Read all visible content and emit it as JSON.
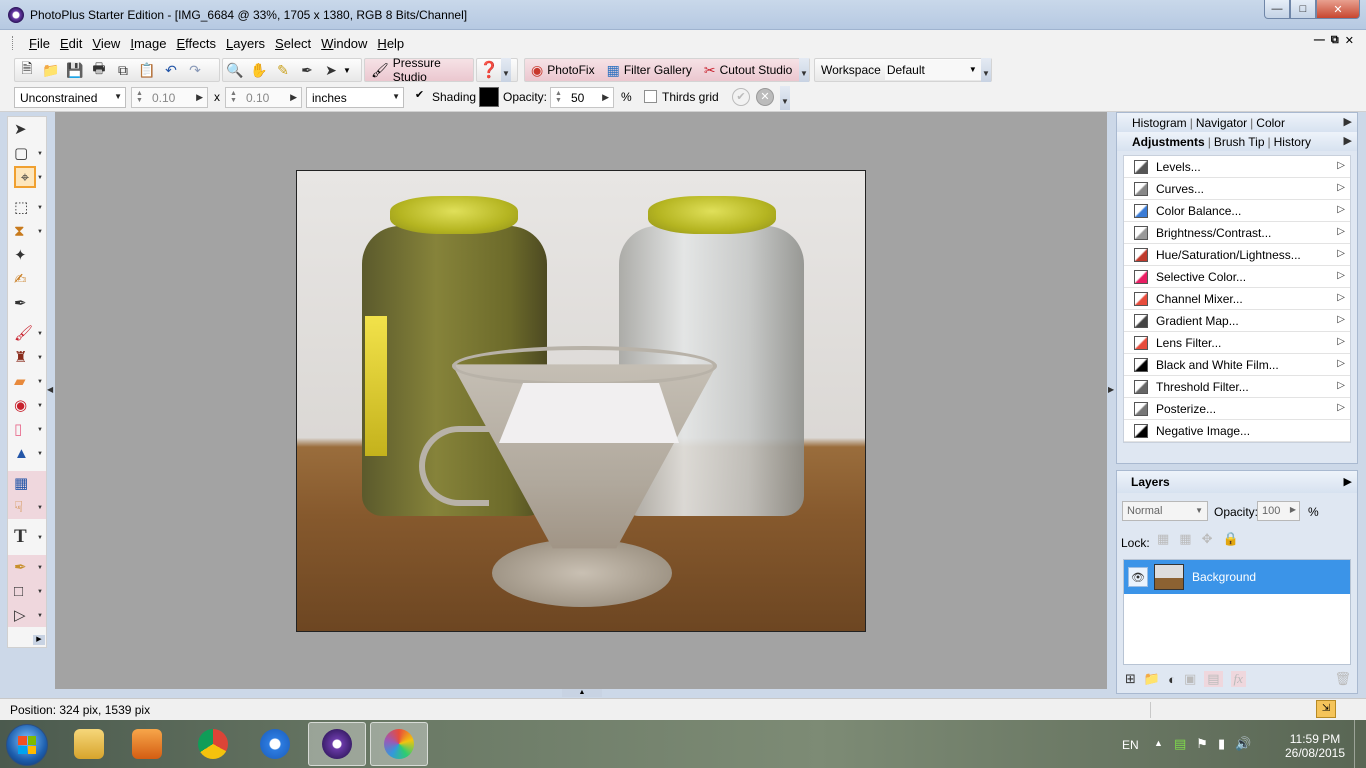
{
  "window": {
    "title": "PhotoPlus Starter Edition - [IMG_6684 @ 33%, 1705 x 1380, RGB 8 Bits/Channel]"
  },
  "menu": [
    "File",
    "Edit",
    "View",
    "Image",
    "Effects",
    "Layers",
    "Select",
    "Window",
    "Help"
  ],
  "toolbar": {
    "pressure_studio": "Pressure Studio",
    "photofix": "PhotoFix",
    "filter_gallery": "Filter Gallery",
    "cutout_studio": "Cutout Studio",
    "workspace_label": "Workspace",
    "workspace_value": "Default"
  },
  "context_bar": {
    "constraint": "Unconstrained",
    "width": "0.10",
    "times": "x",
    "height": "0.10",
    "units": "inches",
    "shading_label": "Shading",
    "shading_checked": "✔",
    "opacity_label": "Opacity:",
    "opacity_value": "50",
    "percent": "%",
    "thirds_grid_label": "Thirds grid"
  },
  "panels": {
    "top_tabs": [
      "Histogram",
      "Navigator",
      "Color"
    ],
    "adj_tabs": [
      "Adjustments",
      "Brush Tip",
      "History"
    ],
    "adjustments": [
      {
        "label": "Levels...",
        "icon": "levels-icon",
        "color": "#555555"
      },
      {
        "label": "Curves...",
        "icon": "curves-icon",
        "color": "#888888"
      },
      {
        "label": "Color Balance...",
        "icon": "color-balance-icon",
        "color": "#3a7bd5"
      },
      {
        "label": "Brightness/Contrast...",
        "icon": "brightness-icon",
        "color": "#999999"
      },
      {
        "label": "Hue/Saturation/Lightness...",
        "icon": "hue-icon",
        "color": "#c0392b"
      },
      {
        "label": "Selective Color...",
        "icon": "selective-color-icon",
        "color": "#e91e63"
      },
      {
        "label": "Channel Mixer...",
        "icon": "channel-mixer-icon",
        "color": "#e74c3c"
      },
      {
        "label": "Gradient Map...",
        "icon": "gradient-map-icon",
        "color": "#444444"
      },
      {
        "label": "Lens Filter...",
        "icon": "lens-filter-icon",
        "color": "#e74c3c"
      },
      {
        "label": "Black and White Film...",
        "icon": "bw-film-icon",
        "color": "#000000"
      },
      {
        "label": "Threshold Filter...",
        "icon": "threshold-icon",
        "color": "#666666"
      },
      {
        "label": "Posterize...",
        "icon": "posterize-icon",
        "color": "#777777"
      },
      {
        "label": "Negative Image...",
        "icon": "negative-icon",
        "color": "#000000"
      }
    ],
    "layers": {
      "title": "Layers",
      "blend_mode": "Normal",
      "opacity_label": "Opacity:",
      "opacity_value": "100",
      "percent": "%",
      "lock_label": "Lock:",
      "layer_name": "Background"
    }
  },
  "status": {
    "position": "Position: 324 pix, 1539 pix"
  },
  "taskbar": {
    "lang": "EN",
    "time": "11:59 PM",
    "date": "26/08/2015"
  }
}
